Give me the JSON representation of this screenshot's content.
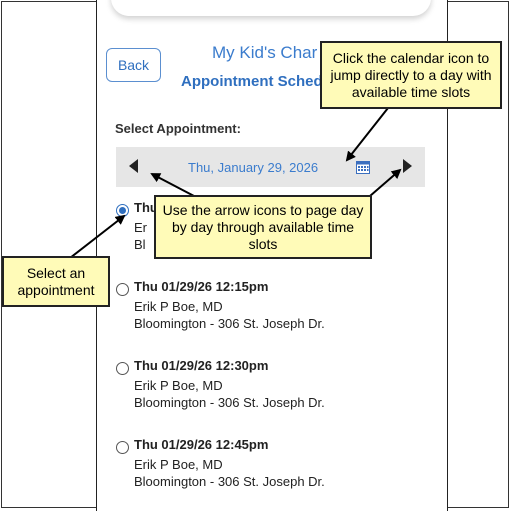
{
  "header": {
    "back_label": "Back",
    "app_title": "My Kid's Char",
    "page_subtitle": "Appointment Sched"
  },
  "section_label": "Select Appointment:",
  "date_nav": {
    "date": "Thu, January 29, 2026",
    "calendar_icon": "calendar-icon",
    "prev_icon": "left-arrow-icon",
    "next_icon": "right-arrow-icon"
  },
  "appointments": [
    {
      "time": "Thu",
      "provider": "Er",
      "location": "Bl",
      "selected": true
    },
    {
      "time": "Thu 01/29/26 12:15pm",
      "provider": "Erik P Boe, MD",
      "location": "Bloomington - 306 St. Joseph Dr.",
      "selected": false
    },
    {
      "time": "Thu 01/29/26 12:30pm",
      "provider": "Erik P Boe, MD",
      "location": "Bloomington - 306 St. Joseph Dr.",
      "selected": false
    },
    {
      "time": "Thu 01/29/26 12:45pm",
      "provider": "Erik P Boe, MD",
      "location": "Bloomington - 306 St. Joseph Dr.",
      "selected": false
    }
  ],
  "callouts": {
    "calendar": "Click the calendar icon to jump directly to a day with available time slots",
    "arrows": "Use the arrow icons to page day by day through available time slots",
    "select": "Select an appointment"
  },
  "colors": {
    "accent": "#3b7ccd",
    "callout_bg": "#fffbb8",
    "nav_bg": "#e6e6e6"
  }
}
